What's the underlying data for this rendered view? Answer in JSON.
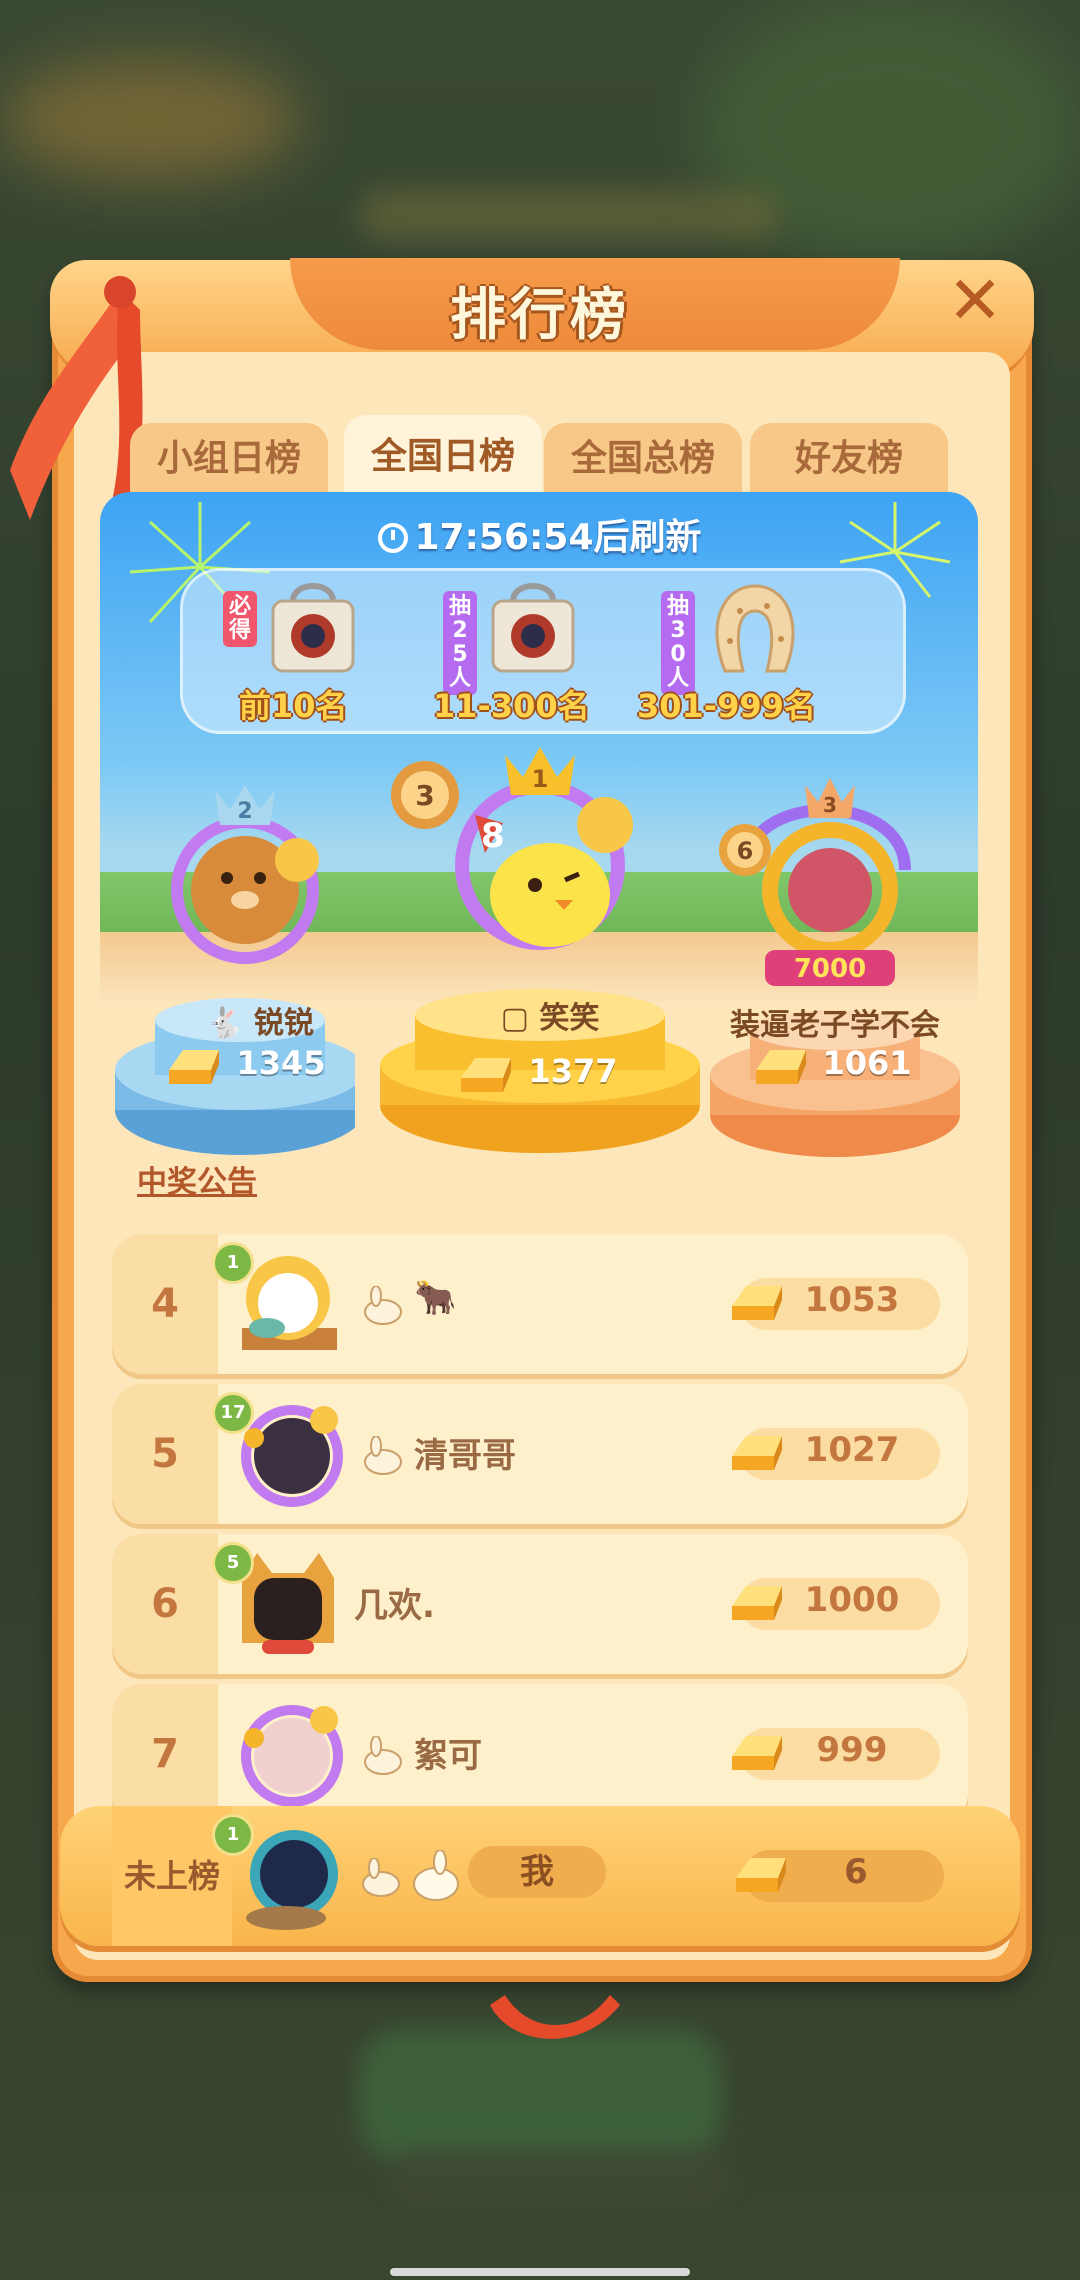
{
  "window": {
    "title": "排行榜",
    "close_label": "✕"
  },
  "tabs": [
    {
      "label": "小组日榜",
      "active": false
    },
    {
      "label": "全国日榜",
      "active": true
    },
    {
      "label": "全国总榜",
      "active": false
    },
    {
      "label": "好友榜",
      "active": false
    }
  ],
  "refresh": {
    "time": "17:56:54",
    "suffix": "后刷新"
  },
  "prizes": [
    {
      "tag": "必得",
      "label": "前10名",
      "tag_color": "#f0566c"
    },
    {
      "tag": "抽25人",
      "label": "11-300名",
      "tag_color": "#b56bf0"
    },
    {
      "tag": "抽30人",
      "label": "301-999名",
      "tag_color": "#b56bf0"
    }
  ],
  "podium": [
    {
      "place": "2",
      "name": "锐锐",
      "score": "1345",
      "level": ""
    },
    {
      "place": "1",
      "name": "笑笑",
      "score": "1377",
      "level": "3",
      "badge": "8"
    },
    {
      "place": "3",
      "name": "装逼老子学不会",
      "score": "1061",
      "level": "6",
      "badge": "7000"
    }
  ],
  "announcement": "中奖公告",
  "list": [
    {
      "rank": "4",
      "name": "🐂",
      "score": "1053",
      "level": "1"
    },
    {
      "rank": "5",
      "name": "清哥哥",
      "score": "1027",
      "level": "17"
    },
    {
      "rank": "6",
      "name": "几欢.",
      "score": "1000",
      "level": "5"
    },
    {
      "rank": "7",
      "name": "絮可",
      "score": "999",
      "level": ""
    }
  ],
  "me": {
    "rank": "未上榜",
    "name": "我",
    "score": "6",
    "level": "1"
  },
  "colors": {
    "panel": "#f7a84c",
    "tab_active": "#fff3d9",
    "gold": "#f5b52a",
    "sky": "#3da3f4"
  }
}
